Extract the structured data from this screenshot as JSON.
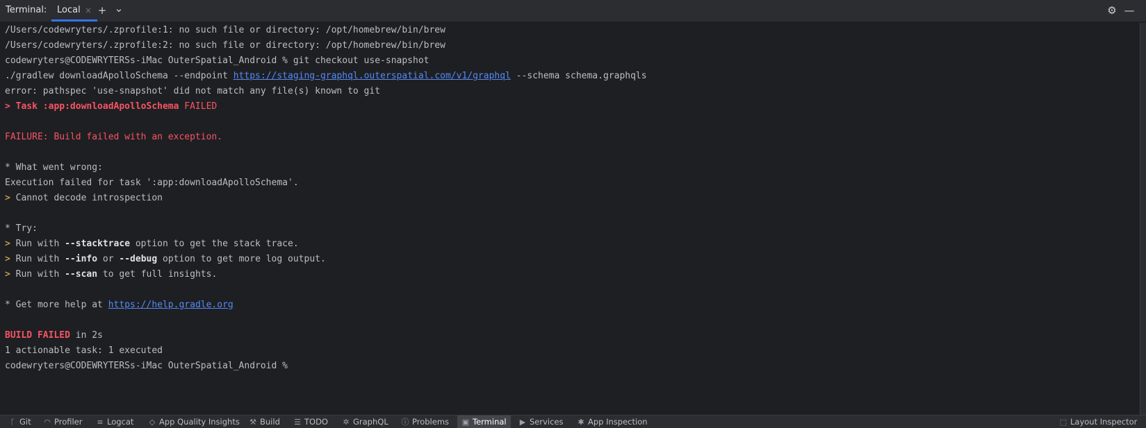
{
  "header": {
    "title": "Terminal:",
    "tab_label": "Local",
    "tab_close": "×",
    "add": "+",
    "dropdown": "⌄",
    "settings": "⚙",
    "minimize": "—"
  },
  "terminal": {
    "l1": "/Users/codewryters/.zprofile:1: no such file or directory: /opt/homebrew/bin/brew",
    "l2": "/Users/codewryters/.zprofile:2: no such file or directory: /opt/homebrew/bin/brew",
    "l3": "codewryters@CODEWRYTERSs-iMac OuterSpatial_Android % git checkout use-snapshot",
    "l4_a": "./gradlew downloadApolloSchema --endpoint ",
    "l4_link": "https://staging-graphql.outerspatial.com/v1/graphql",
    "l4_b": " --schema schema.graphqls",
    "l5": "error: pathspec 'use-snapshot' did not match any file(s) known to git",
    "l6_a": "> Task :app:downloadApolloSchema",
    "l6_b": " FAILED",
    "l8": "FAILURE: Build failed with an exception.",
    "l10": "* What went wrong:",
    "l11": "Execution failed for task ':app:downloadApolloSchema'.",
    "prompt_gt": ">",
    "l12": " Cannot decode introspection",
    "l14": "* Try:",
    "run_with": " Run with ",
    "l15_opt": "--stacktrace",
    "l15_rest": " option to get the stack trace.",
    "l16_opt1": "--info",
    "l16_or": " or ",
    "l16_opt2": "--debug",
    "l16_rest": " option to get more log output.",
    "l17_opt": "--scan",
    "l17_rest": " to get full insights.",
    "l19_a": "* Get more help at ",
    "l19_link": "https://help.gradle.org",
    "l21_a": "BUILD FAILED",
    "l21_b": " in 2s",
    "l22": "1 actionable task: 1 executed",
    "l23": "codewryters@CODEWRYTERSs-iMac OuterSpatial_Android %"
  },
  "statusbar": {
    "git": "Git",
    "profiler": "Profiler",
    "logcat": "Logcat",
    "aqi": "App Quality Insights",
    "build": "Build",
    "todo": "TODO",
    "graphql": "GraphQL",
    "problems": "Problems",
    "terminal": "Terminal",
    "services": "Services",
    "app_inspection": "App Inspection",
    "layout_inspector": "Layout Inspector"
  },
  "icons": {
    "git": "ᚴ",
    "profiler": "◠",
    "logcat": "≡",
    "aqi": "◇",
    "build": "⚒",
    "todo": "☰",
    "graphql": "✲",
    "problems": "ⓘ",
    "terminal": "▣",
    "services": "▶",
    "app_inspection": "✱",
    "layout_inspector": "⬚"
  }
}
